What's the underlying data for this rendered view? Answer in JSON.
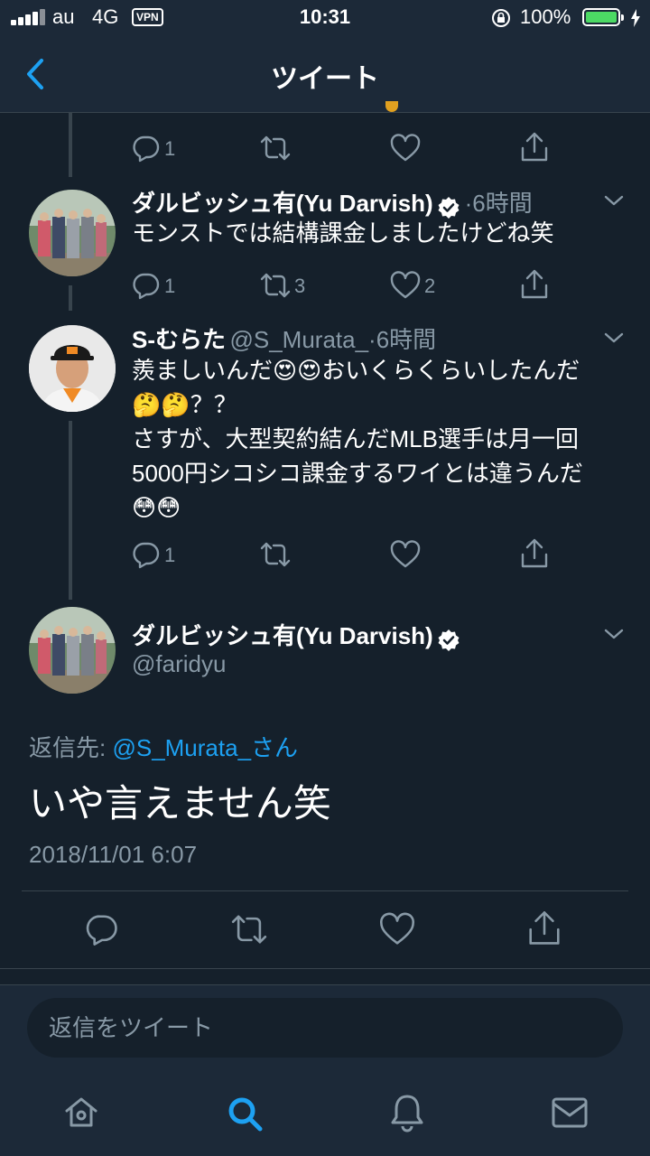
{
  "status_bar": {
    "carrier": "au",
    "network": "4G",
    "vpn": "VPN",
    "time": "10:31",
    "battery": "100%",
    "battery_level": 1.0
  },
  "nav": {
    "title": "ツイート"
  },
  "tweets": [
    {
      "actions": {
        "reply": "1",
        "retweet": "",
        "like": ""
      }
    },
    {
      "name": "ダルビッシュ有(Yu Darvish)",
      "verified": true,
      "time": "·6時間",
      "text": "モンストでは結構課金しましたけどね笑",
      "actions": {
        "reply": "1",
        "retweet": "3",
        "like": "2"
      }
    },
    {
      "name": "S-むらた",
      "handle": "@S_Murata_",
      "time": "·6時間",
      "text_lines": [
        "羨ましいんだ😍😍おいくらくらいしたんだ",
        "🤔🤔？？",
        "さすが、大型契約結んだMLB選手は月一回",
        "5000円シコシコ課金するワイとは違うんだ",
        "😳😳"
      ],
      "actions": {
        "reply": "1",
        "retweet": "",
        "like": ""
      }
    }
  ],
  "main_tweet": {
    "name": "ダルビッシュ有(Yu Darvish)",
    "handle": "@faridyu",
    "reply_to_label": "返信先: ",
    "reply_to_link": "@S_Murata_さん",
    "text": "いや言えません笑",
    "timestamp": "2018/11/01 6:07"
  },
  "reply_box": {
    "placeholder": "返信をツイート"
  },
  "tab_bar": [
    "home-icon",
    "search-icon",
    "notifications-icon",
    "messages-icon"
  ],
  "colors": {
    "background": "#15202b",
    "bar": "#1c2938",
    "accent": "#1da1f2",
    "muted": "#8899a6"
  }
}
